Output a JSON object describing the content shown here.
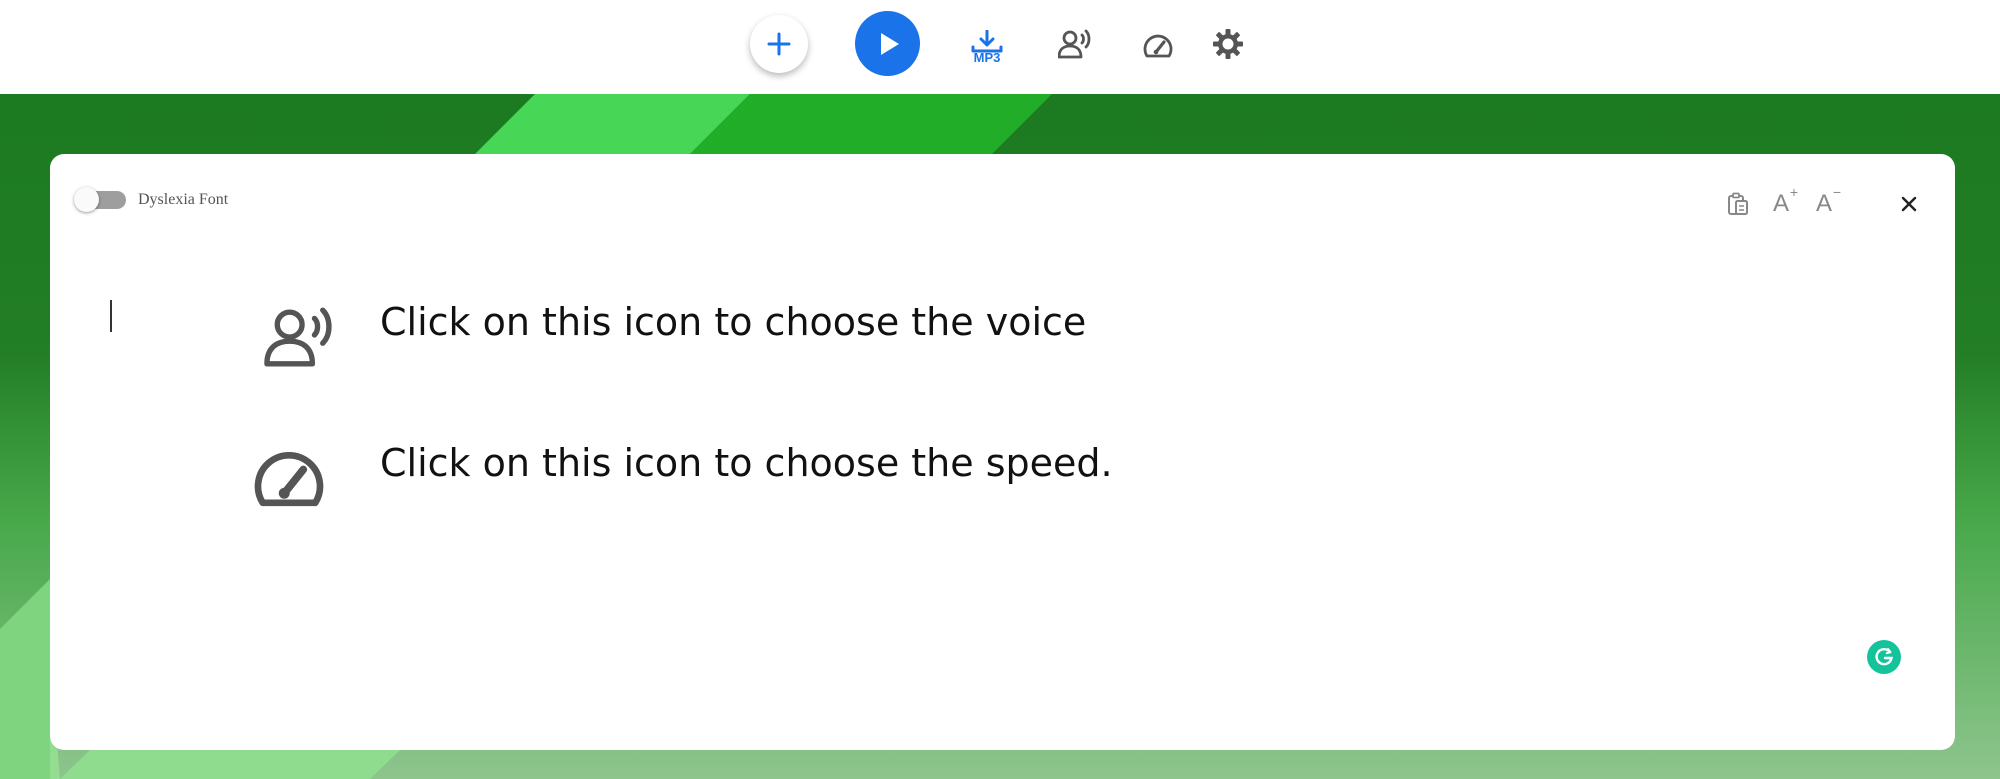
{
  "toolbar": {
    "add_icon": "plus-icon",
    "play_icon": "play-icon",
    "download_label": "MP3",
    "download_icon": "download-icon",
    "voice_icon": "voice-icon",
    "speed_icon": "speedometer-icon",
    "settings_icon": "gear-icon"
  },
  "editor_card": {
    "dyslexia_toggle": {
      "label": "Dyslexia Font",
      "on": false
    },
    "tools": {
      "clipboard_icon": "clipboard-icon",
      "font_increase": {
        "glyph": "A",
        "sup": "+"
      },
      "font_decrease": {
        "glyph": "A",
        "sup": "−"
      },
      "close": "×"
    },
    "content": {
      "line_voice": "Click on this icon to choose the voice",
      "line_speed": "Click on this icon to choose the speed."
    }
  },
  "colors": {
    "accent_blue": "#1a73e8",
    "icon_gray": "#555555",
    "grammarly_green": "#15c39a",
    "bg_dark_green": "#1e7a22",
    "bg_light_green": "#8fcf8f"
  }
}
